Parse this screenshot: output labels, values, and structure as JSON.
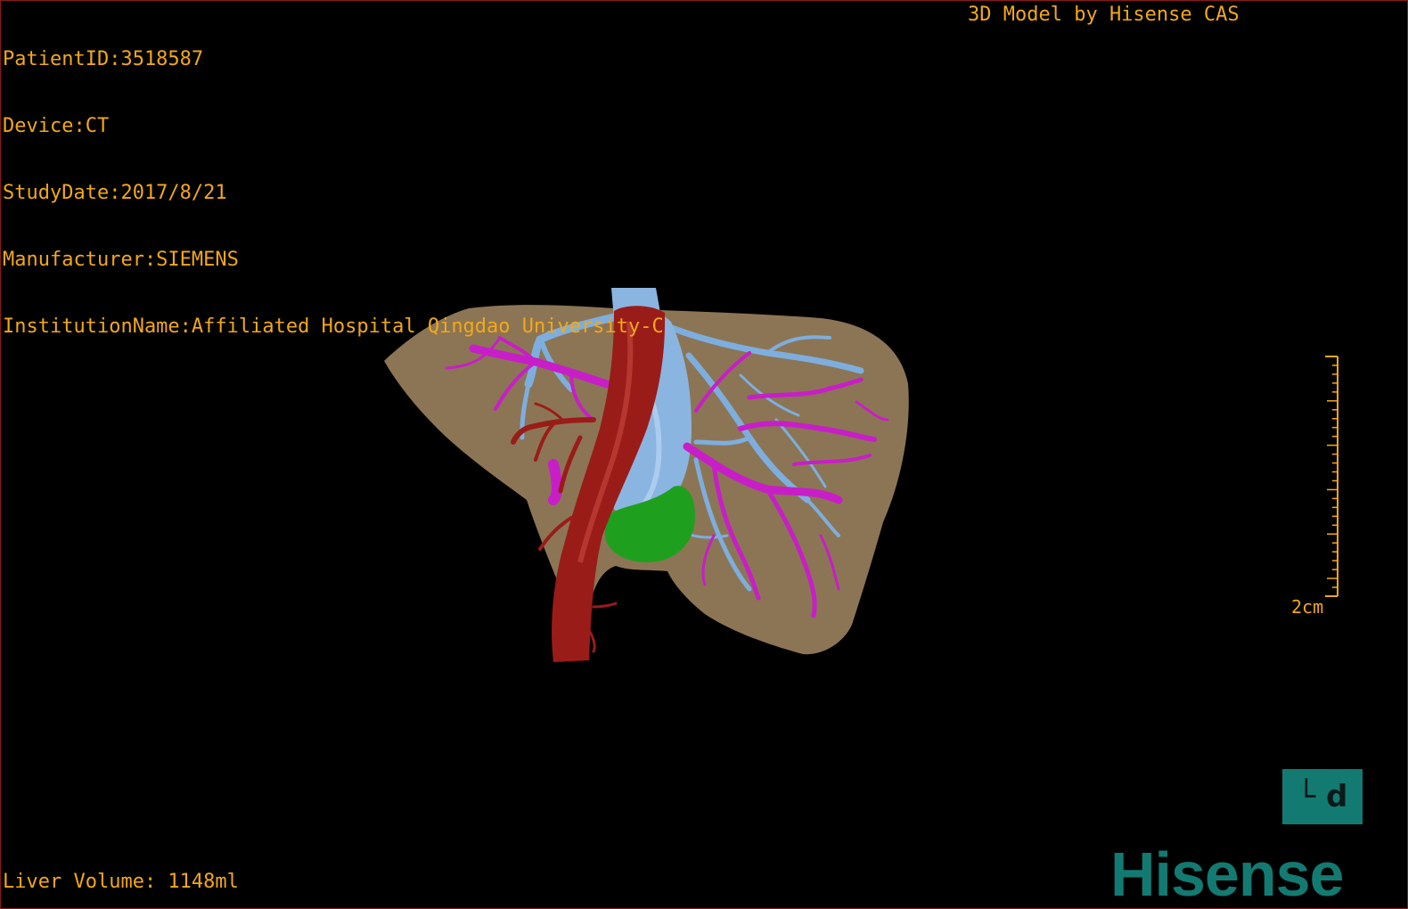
{
  "overlay": {
    "patient_id": "PatientID:3518587",
    "device": "Device:CT",
    "study_date": "StudyDate:2017/8/21",
    "manufacturer": "Manufacturer:SIEMENS",
    "institution": "InstitutionName:Affiliated Hospital Qingdao University-C",
    "credit": "3D Model by Hisense CAS",
    "liver_volume": "Liver Volume: 1148ml"
  },
  "scale": {
    "label": "2cm"
  },
  "view_toggle": {
    "icon": "view-orientation-icon",
    "label": "└ d"
  },
  "brand": {
    "logo_text": "Hisense"
  },
  "colors": {
    "overlay_text": "#f2a818",
    "liver": "#8c7555",
    "artery": "#9a1c18",
    "portal_vein": "#c81ec8",
    "hepatic_vein": "#7eaede",
    "gallbladder": "#1ea01e",
    "brand": "#137a72",
    "frame": "#8a1a1a"
  }
}
